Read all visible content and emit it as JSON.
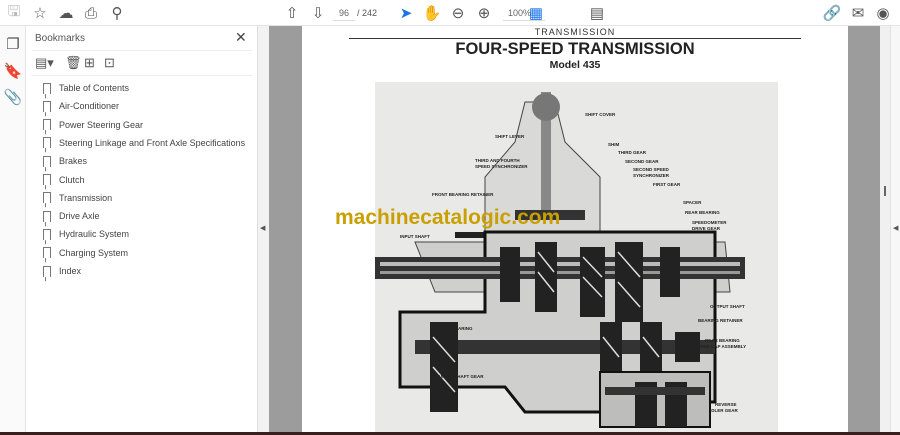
{
  "toolbar": {
    "page_current": "96",
    "page_total": "/ 242",
    "zoom": "100%",
    "tools": [
      "save-icon",
      "bookmark-star-icon",
      "upload-icon",
      "print-icon",
      "search-zoom-icon",
      "previous-page-icon",
      "next-page-icon",
      "select-cursor-icon",
      "hand-icon",
      "zoom-out-icon",
      "zoom-in-icon",
      "fit-page-icon",
      "read-mode-icon",
      "share-link-icon",
      "email-icon",
      "account-icon"
    ]
  },
  "panel": {
    "title": "Bookmarks",
    "bookmarks": [
      "Table of Contents",
      "Air-Conditioner",
      "Power Steering Gear",
      "Steering Linkage and Front Axle Specifications",
      "Brakes",
      "Clutch",
      "Transmission",
      "Drive Axle",
      "Hydraulic System",
      "Charging System",
      "Index"
    ]
  },
  "document": {
    "header": "TRANSMISSION",
    "title": "FOUR-SPEED TRANSMISSION",
    "subtitle": "Model 435",
    "watermark": "machinecatalogic.com",
    "figure_labels": {
      "shift_cover": "SHIFT COVER",
      "shift_lever": "SHIFT LEVER",
      "shim": "SHIM",
      "third_gear": "THIRD GEAR",
      "second_gear": "SECOND GEAR",
      "sync34_1": "THIRD AND FOURTH",
      "sync34_2": "SPEED SYNCHRONIZER",
      "sync2_1": "SECOND SPEED",
      "sync2_2": "SYNCHRONIZER",
      "first_gear": "FIRST GEAR",
      "front_bearing_retainer": "FRONT BEARING RETAINER",
      "spacer": "SPACER",
      "rear_bearing": "REAR BEARING",
      "speedo_1": "SPEEDOMETER",
      "speedo_2": "DRIVE GEAR",
      "input_shaft": "INPUT SHAFT",
      "output_shaft": "OUTPUT SHAFT",
      "bearing_retainer": "BEARING RETAINER",
      "front_bearing": "FRONT BEARING",
      "rear_cap_1": "REAR BEARING",
      "rear_cap_2": "AND CAP ASSEMBLY",
      "countershaft_gear": "COUNTERSHAFT GEAR",
      "reverse_1": "REVERSE",
      "reverse_2": "IDLER GEAR"
    }
  },
  "colors": {
    "watermark": "#c9a000",
    "accent": "#1a73e8",
    "doc_bg": "#9c9c9c"
  }
}
